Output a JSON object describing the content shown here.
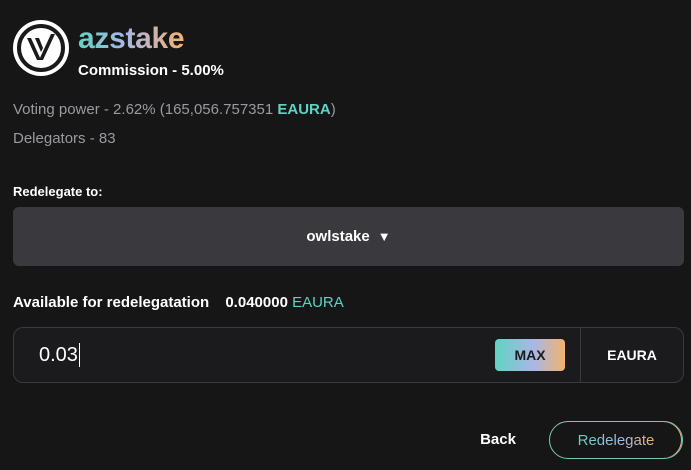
{
  "validator": {
    "name": "azstake",
    "commission": "Commission - 5.00%",
    "voting_power_text": "Voting power - 2.62%  (165,056.757351 ",
    "voting_power_token": "EAURA",
    "voting_power_close": ")",
    "delegators": "Delegators - 83"
  },
  "redelegate": {
    "label": "Redelegate to:",
    "selected": "owlstake",
    "caret_glyph": "▼"
  },
  "available": {
    "label": "Available for redelegatation",
    "amount": "0.040000",
    "token": "EAURA"
  },
  "input": {
    "value": "0.03",
    "max_label": "MAX",
    "unit": "EAURA"
  },
  "actions": {
    "back_label": "Back",
    "redelegate_label": "Redelegate"
  },
  "colors": {
    "accent": "#5fd3c2",
    "gradient_end": "#f3b26e",
    "background": "#161617"
  }
}
